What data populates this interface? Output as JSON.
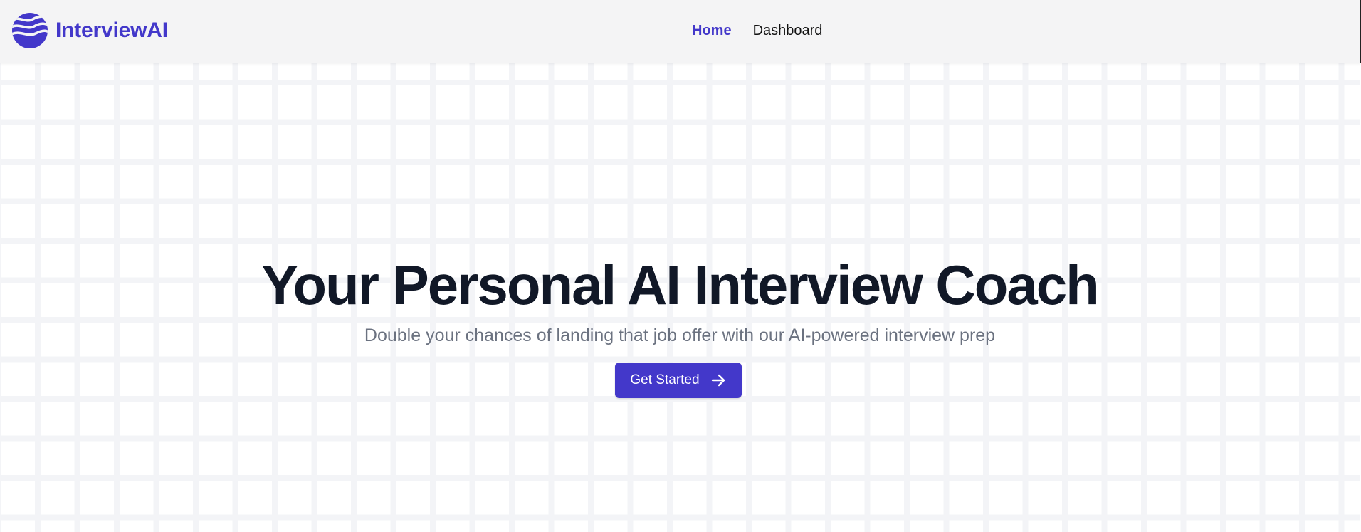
{
  "brand": {
    "name": "InterviewAI",
    "icon": "wave-logo-icon",
    "color": "#4338ca"
  },
  "nav": {
    "items": [
      {
        "label": "Home",
        "active": true
      },
      {
        "label": "Dashboard",
        "active": false
      }
    ]
  },
  "hero": {
    "title": "Your Personal AI Interview Coach",
    "subtitle": "Double your chances of landing that job offer with our AI-powered interview prep",
    "cta": {
      "label": "Get Started",
      "icon": "arrow-right-icon"
    }
  },
  "colors": {
    "accent": "#4338ca",
    "title": "#111827",
    "subtitle": "#6b7280",
    "navbar_bg": "#f4f4f5",
    "grid_line": "#f3f4f7"
  }
}
